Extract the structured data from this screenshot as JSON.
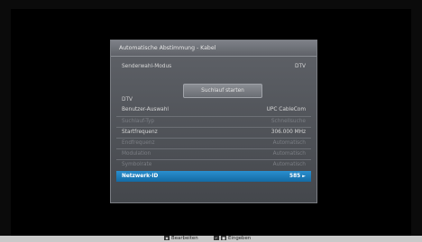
{
  "dialog": {
    "title": "Automatische Abstimmung - Kabel",
    "mode_label": "Senderwahl-Modus",
    "mode_value": "DTV",
    "start_button": "Suchlauf starten",
    "section": "DTV",
    "rows": [
      {
        "label": "Benutzer-Auswahl",
        "value": "UPC CableCom"
      },
      {
        "label": "Suchlauf-Typ",
        "value": "Schnellsuche"
      },
      {
        "label": "Startfrequenz",
        "value": "306.000 MHz"
      },
      {
        "label": "Endfrequenz",
        "value": "Automatisch"
      },
      {
        "label": "Modulation",
        "value": "Automatisch"
      },
      {
        "label": "Symbolrate",
        "value": "Automatisch"
      },
      {
        "label": "Netzwerk-ID",
        "value": "585"
      }
    ]
  },
  "footer": {
    "edit_label": "Bearbeiten",
    "enter_label": "Eingeben"
  },
  "colors": {
    "selection": "#1f7fbf",
    "panel": "#55585e"
  }
}
